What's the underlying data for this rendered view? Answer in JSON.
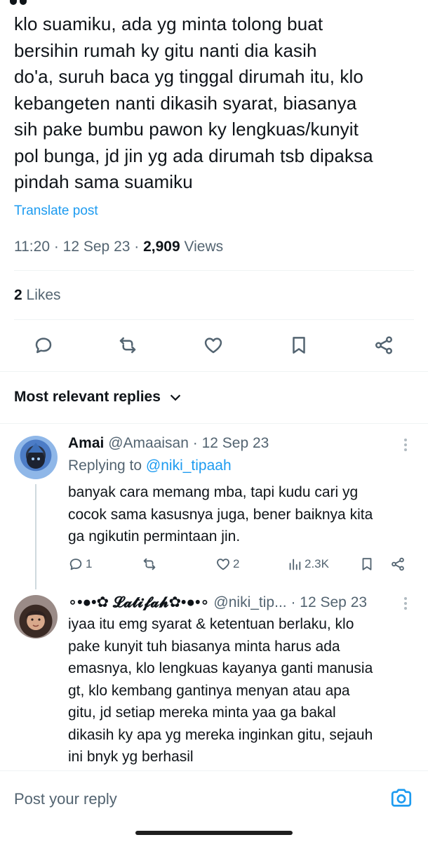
{
  "post": {
    "lines": [
      "klo suamiku, ada yg minta tolong buat",
      "bersihin rumah ky gitu nanti dia kasih",
      "do'a, suruh baca yg tinggal dirumah itu, klo",
      "kebangeten nanti dikasih syarat, biasanya",
      "sih pake bumbu pawon ky lengkuas/kunyit",
      "pol bunga, jd jin yg ada dirumah tsb dipaksa",
      "pindah sama suamiku"
    ],
    "translate_label": "Translate post",
    "time": "11:20",
    "date": "12 Sep 23",
    "views_count": "2,909",
    "views_label": "Views",
    "likes_count": "2",
    "likes_label": "Likes"
  },
  "actions": {
    "icons": [
      "reply-icon",
      "repost-icon",
      "like-icon",
      "bookmark-icon",
      "share-icon"
    ]
  },
  "replies_section": {
    "sort_label": "Most relevant replies"
  },
  "replies": [
    {
      "name": "Amai",
      "handle": "@Amaaisan",
      "date": "12 Sep 23",
      "replying_prefix": "Replying to",
      "replying_handle": "@niki_tipaah",
      "lines": [
        "banyak cara memang mba, tapi kudu cari yg",
        "cocok sama kasusnya juga, bener baiknya kita",
        "ga ngikutin permintaan jin."
      ],
      "reply_count": "1",
      "like_count": "2",
      "view_count": "2.3K"
    },
    {
      "name": "∘•●•✿ 𝓛𝓪𝓽𝓲𝓯𝓪𝓱✿•●•∘",
      "handle": "@niki_tip...",
      "date": "12 Sep 23",
      "lines": [
        "iyaa itu emg syarat & ketentuan berlaku, klo",
        "pake kunyit tuh biasanya minta harus ada",
        "emasnya, klo lengkuas kayanya ganti manusia",
        "gt, klo kembang gantinya menyan atau apa",
        "gitu, jd setiap mereka minta yaa ga bakal",
        "dikasih ky apa yg mereka inginkan gitu, sejauh",
        "ini bnyk yg berhasil"
      ]
    }
  ],
  "composer": {
    "placeholder": "Post your reply"
  },
  "colors": {
    "accent": "#1d9bf0",
    "text": "#0f1419",
    "muted": "#536471"
  }
}
